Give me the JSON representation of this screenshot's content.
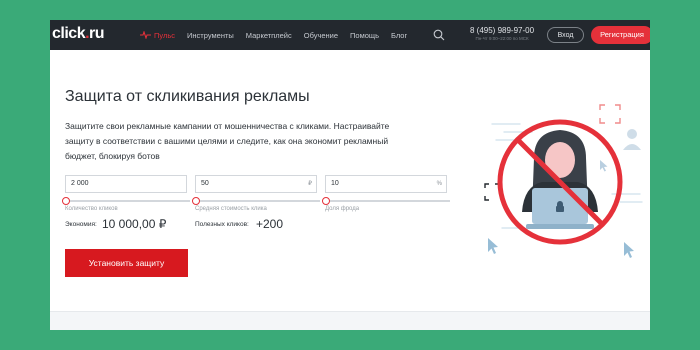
{
  "header": {
    "logo": {
      "name": "click",
      "dot": ".",
      "tld": "ru"
    },
    "nav": [
      {
        "label": "Пульс",
        "icon": "pulse-icon",
        "active": true
      },
      {
        "label": "Инструменты"
      },
      {
        "label": "Маркетплейс"
      },
      {
        "label": "Обучение"
      },
      {
        "label": "Помощь"
      },
      {
        "label": "Блог"
      }
    ],
    "search_icon": "search-icon",
    "phone": "8 (495) 989-97-00",
    "hours": "Пн-Чт 9:00–22:00 по МСК",
    "login_label": "Вход",
    "register_label": "Регистрация"
  },
  "main": {
    "title": "Защита от скликивания рекламы",
    "description": "Защитите свои рекламные кампании от мошенничества с кликами. Настраивайте защиту в соответствии с вашими целями и следите, как она экономит рекламный бюджет, блокируя ботов",
    "fields": [
      {
        "value": "2 000",
        "suffix": "",
        "hint": "Количество кликов",
        "slider_level": 0
      },
      {
        "value": "50",
        "suffix": "₽",
        "hint": "Средняя стоимость клика",
        "slider_level": 0
      },
      {
        "value": "10",
        "suffix": "%",
        "hint": "Доля фрода",
        "slider_level": 0
      }
    ],
    "savings_label": "Экономия:",
    "savings_value": "10 000,00 ₽",
    "useful_clicks_label": "Полезных кликов:",
    "useful_clicks_value": "+200",
    "cta_label": "Установить защиту"
  },
  "colors": {
    "accent": "#e5313a",
    "nav_bg": "#23282e",
    "page_bg": "#3aaa78",
    "illustration_blue": "#97bdd6"
  },
  "illustration": {
    "icons": [
      "hacker-icon",
      "laptop-icon",
      "prohibited-sign-icon",
      "cursor-icon",
      "user-icon",
      "focus-bracket-icon"
    ]
  }
}
